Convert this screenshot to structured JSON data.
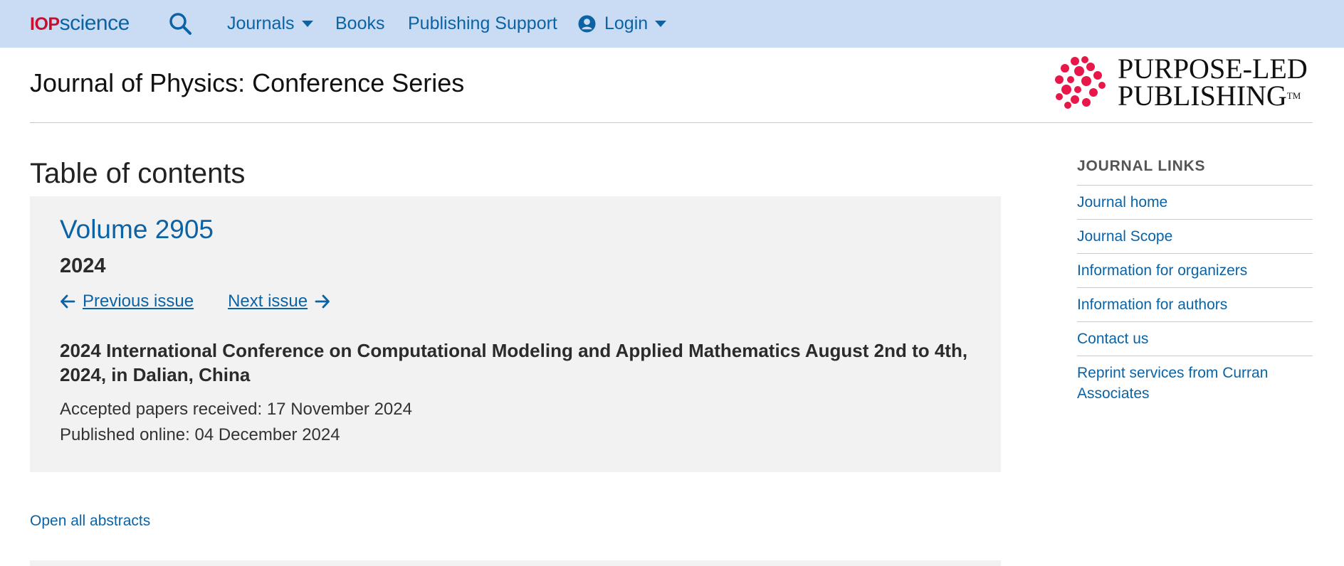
{
  "topbar": {
    "brand_prefix": "IOP",
    "brand_suffix": "science",
    "search_icon": "search-icon",
    "nav": {
      "journals": "Journals",
      "books": "Books",
      "publishing_support": "Publishing Support",
      "login": "Login"
    },
    "background_color": "#c9dcf3",
    "link_color": "#0b63a5",
    "brand_red": "#c8102e"
  },
  "header": {
    "journal_title": "Journal of Physics: Conference Series",
    "logo_line1": "PURPOSE-LED",
    "logo_line2": "PUBLISHING",
    "logo_tm": "TM",
    "logo_mark_color": "#e8174a"
  },
  "main": {
    "toc_heading": "Table of contents",
    "issue": {
      "volume_title": "Volume 2905",
      "year": "2024",
      "previous_label": "Previous issue",
      "next_label": "Next issue",
      "conference_title": "2024 International Conference on Computational Modeling and Applied Mathematics August 2nd to 4th, 2024, in Dalian, China",
      "accepted_line": "Accepted papers received: 17 November 2024",
      "published_line": "Published online: 04 December 2024"
    },
    "open_all_abstracts": "Open all abstracts"
  },
  "sidebar": {
    "heading": "JOURNAL LINKS",
    "links": [
      "Journal home",
      "Journal Scope",
      "Information for organizers",
      "Information for authors",
      "Contact us",
      "Reprint services from Curran Associates"
    ]
  }
}
